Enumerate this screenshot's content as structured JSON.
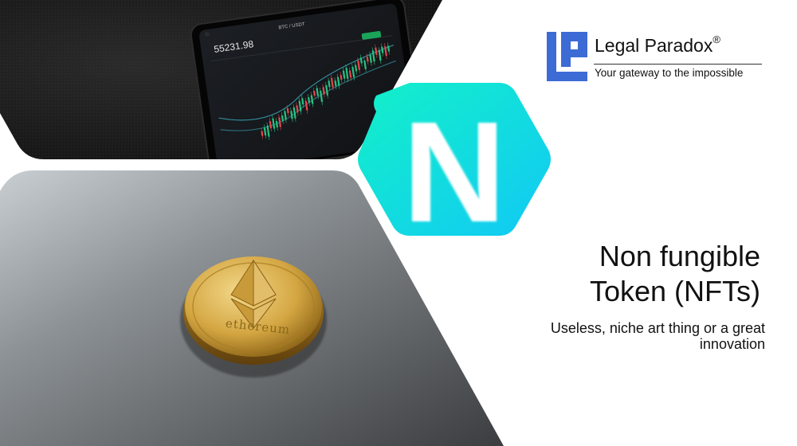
{
  "logo": {
    "name": "Legal Paradox",
    "registered": "®",
    "tagline": "Your gateway to the impossible",
    "mark_letters": "LP",
    "brand_color": "#3d6bd6"
  },
  "heading": {
    "line1": "Non fungible",
    "line2": "Token (NFTs)"
  },
  "subheading": "Useless, niche art thing or a great innovation",
  "badge": {
    "letter": "N",
    "gradient_start": "#13f0c8",
    "gradient_end": "#11c9f5"
  },
  "phone_photo": {
    "price": "55231.98",
    "pair": "BTC / USDT"
  },
  "coin_photo": {
    "engraving": "ethereum"
  }
}
